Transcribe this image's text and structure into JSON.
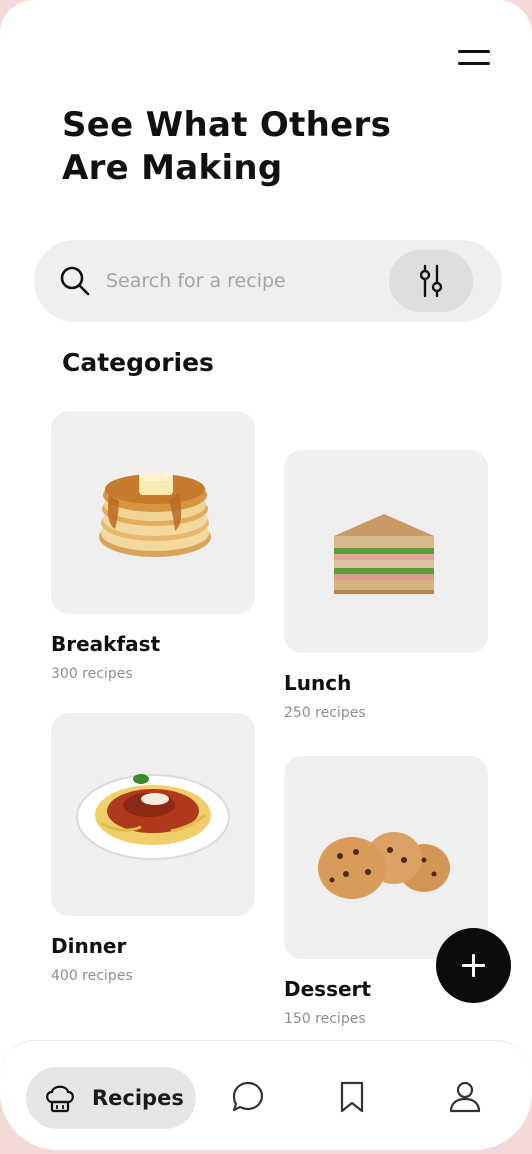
{
  "header": {
    "menu_icon": "hamburger-menu-icon",
    "title": "See What Others Are Making"
  },
  "search": {
    "placeholder": "Search for a recipe",
    "value": "",
    "icon": "search-icon",
    "filter_icon": "filter-sliders-icon"
  },
  "categories": {
    "title": "Categories",
    "items": [
      {
        "name": "Breakfast",
        "count": "300 recipes",
        "image": "pancakes"
      },
      {
        "name": "Lunch",
        "count": "250 recipes",
        "image": "sandwich"
      },
      {
        "name": "Dinner",
        "count": "400 recipes",
        "image": "spaghetti"
      },
      {
        "name": "Dessert",
        "count": "150 recipes",
        "image": "cookies"
      }
    ]
  },
  "fab": {
    "icon": "plus-icon"
  },
  "bottom_nav": {
    "active_label": "Recipes",
    "items": [
      {
        "label": "Recipes",
        "icon": "chef-hat-icon",
        "active": true
      },
      {
        "label": "",
        "icon": "chat-bubble-icon",
        "active": false
      },
      {
        "label": "",
        "icon": "bookmark-icon",
        "active": false
      },
      {
        "label": "",
        "icon": "profile-icon",
        "active": false
      }
    ]
  },
  "colors": {
    "background": "#f3d9d7",
    "card_bg": "#efefef",
    "fab_bg": "#0c0c0c",
    "muted_text": "#8e8e8e"
  }
}
